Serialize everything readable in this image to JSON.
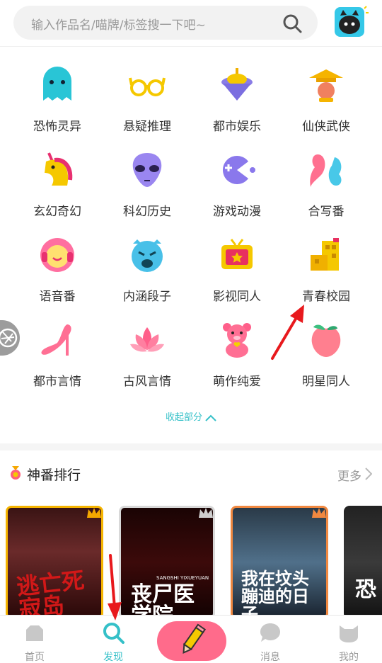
{
  "search": {
    "placeholder": "输入作品名/喵牌/标签搜一下吧~"
  },
  "categories": [
    {
      "label": "恐怖灵异",
      "icon": "ghost-icon"
    },
    {
      "label": "悬疑推理",
      "icon": "glasses-icon"
    },
    {
      "label": "都市娱乐",
      "icon": "spinning-top-icon"
    },
    {
      "label": "仙侠武侠",
      "icon": "straw-hat-icon"
    },
    {
      "label": "玄幻奇幻",
      "icon": "unicorn-icon"
    },
    {
      "label": "科幻历史",
      "icon": "alien-icon"
    },
    {
      "label": "游戏动漫",
      "icon": "pacman-icon"
    },
    {
      "label": "合写番",
      "icon": "fish-pair-icon"
    },
    {
      "label": "语音番",
      "icon": "headphones-face-icon"
    },
    {
      "label": "内涵段子",
      "icon": "crying-face-icon"
    },
    {
      "label": "影视同人",
      "icon": "tv-icon"
    },
    {
      "label": "青春校园",
      "icon": "school-building-icon"
    },
    {
      "label": "都市言情",
      "icon": "high-heel-icon"
    },
    {
      "label": "古风言情",
      "icon": "lotus-icon"
    },
    {
      "label": "萌作纯爱",
      "icon": "teddy-bear-icon"
    },
    {
      "label": "明星同人",
      "icon": "peach-icon"
    }
  ],
  "collapse_label": "收起部分",
  "ranking": {
    "title": "神番排行",
    "more_label": "更多",
    "books": [
      {
        "cover_text": "逃亡死寂岛"
      },
      {
        "cover_text": "丧尸医学院",
        "small_text": "SANGSHI YIXUEYUAN"
      },
      {
        "cover_text": "我在坟头蹦迪的日子"
      },
      {
        "cover_text": "恐"
      }
    ]
  },
  "tabs": [
    {
      "label": "首页",
      "icon": "home-icon"
    },
    {
      "label": "发现",
      "icon": "search-icon",
      "active": true
    },
    {
      "label": "",
      "icon": "pencil-icon"
    },
    {
      "label": "消息",
      "icon": "chat-bubble-icon"
    },
    {
      "label": "我的",
      "icon": "cat-head-icon"
    }
  ],
  "colors": {
    "accent": "#35c0c8",
    "write_button": "#ff6b8b",
    "annotation_arrow": "#e8191d"
  }
}
